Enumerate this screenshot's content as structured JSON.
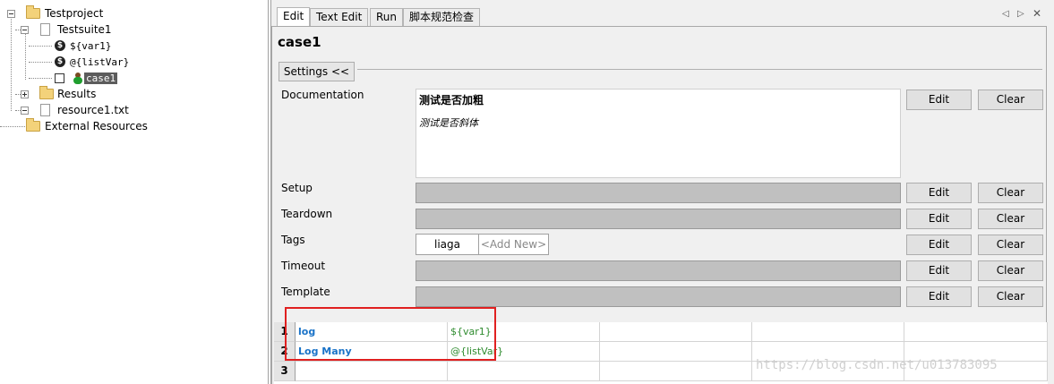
{
  "tree": {
    "project": "Testproject",
    "suite": "Testsuite1",
    "var1": "${var1}",
    "listvar": "@{listVar}",
    "case": "case1",
    "results": "Results",
    "resource": "resource1.txt",
    "external": "External Resources"
  },
  "tabs": [
    "Edit",
    "Text Edit",
    "Run",
    "脚本规范检查"
  ],
  "editor": {
    "case_title": "case1",
    "settings_label": "Settings <<",
    "documentation": {
      "label": "Documentation",
      "bold_text": "测试是否加粗",
      "italic_text": "测试是否斜体"
    },
    "setup_label": "Setup",
    "teardown_label": "Teardown",
    "tags_label": "Tags",
    "timeout_label": "Timeout",
    "template_label": "Template",
    "tags": [
      "liaga"
    ],
    "add_new": "<Add New>",
    "edit_label": "Edit",
    "clear_label": "Clear"
  },
  "grid": {
    "rows": [
      {
        "num": "1",
        "keyword": "log",
        "arg": "${var1}"
      },
      {
        "num": "2",
        "keyword": "Log Many",
        "arg": "@{listVar}"
      },
      {
        "num": "3",
        "keyword": "",
        "arg": ""
      }
    ]
  },
  "watermark": "https://blog.csdn.net/u013783095",
  "colors": {
    "keyword": "#1a73c8",
    "argument": "#2e8b2e",
    "highlight": "#e02020",
    "selection": "#5c5c5c"
  }
}
